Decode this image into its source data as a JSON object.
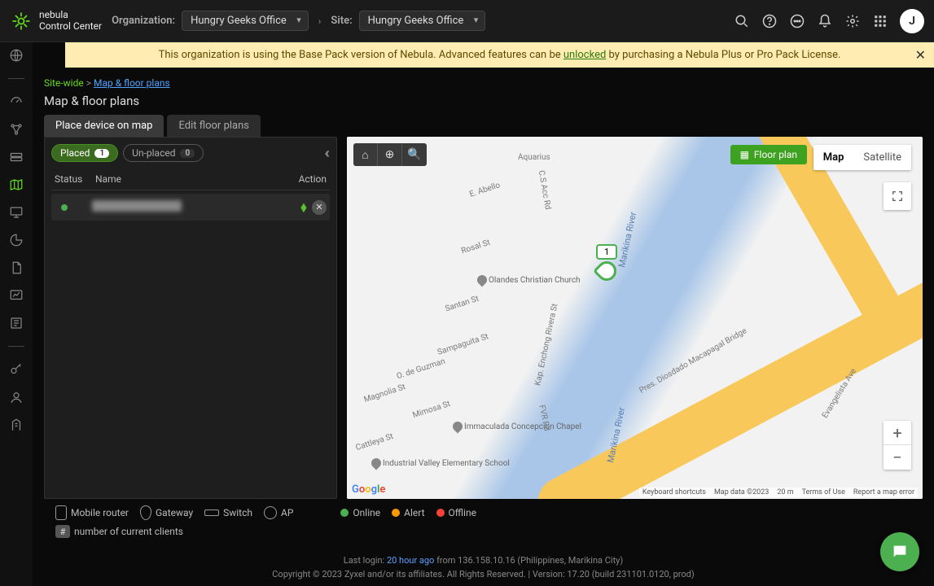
{
  "brand": {
    "name": "nebula",
    "sub": "Control Center"
  },
  "topbar": {
    "org_label": "Organization:",
    "org_value": "Hungry Geeks Office",
    "site_label": "Site:",
    "site_value": "Hungry Geeks Office",
    "avatar_initial": "J"
  },
  "banner": {
    "pre": "This organization is using the Base Pack version of Nebula. Advanced features can be ",
    "link": "unlocked",
    "post": " by purchasing a Nebula Plus or Pro Pack License."
  },
  "crumbs": {
    "root": "Site-wide",
    "sep": ">",
    "leaf": "Map & floor plans"
  },
  "page_title": "Map & floor plans",
  "tabs": {
    "t1": "Place device on map",
    "t2": "Edit floor plans"
  },
  "filters": {
    "placed_label": "Placed",
    "placed_count": "1",
    "unplaced_label": "Un-placed",
    "unplaced_count": "0"
  },
  "table": {
    "h_status": "Status",
    "h_name": "Name",
    "h_action": "Action"
  },
  "map": {
    "toolbar": {
      "home": "⌂",
      "target": "⊕",
      "search": "🔍"
    },
    "floorplan_btn": "Floor plan",
    "type_map": "Map",
    "type_sat": "Satellite",
    "marker_count": "1",
    "river": "Marikina River",
    "bridge": "Pres. Diosdado Macapagal Bridge",
    "poi1": "Olandes Christian Church",
    "poi2": "Immaculada Concepcion Chapel",
    "poi3": "Industrial Valley Elementary School",
    "streets": [
      "E. Abello",
      "Rosal St",
      "Santan St",
      "Sampaguita St",
      "O. de Guzman",
      "Magnolia St",
      "Mimosa St",
      "Cattleya St",
      "Aquarius",
      "C.S Acc Rd",
      "Kap. Enchong Rivera St",
      "FVR Rd",
      "Evangelista Ave"
    ],
    "attr": {
      "shortcuts": "Keyboard shortcuts",
      "data": "Map data ©2023",
      "scale": "20 m",
      "terms": "Terms of Use",
      "report": "Report a map error"
    }
  },
  "legend": {
    "mobile": "Mobile router",
    "gateway": "Gateway",
    "switch": "Switch",
    "ap": "AP",
    "online": "Online",
    "alert": "Alert",
    "offline": "Offline",
    "hash": "#",
    "hash_label": "number of current clients"
  },
  "footer": {
    "login_pre": "Last login:",
    "login_time": "20 hour ago",
    "login_from": "from 136.158.10.16 (Philippines, Marikina City)",
    "copy": "Copyright © 2023 Zyxel and/or its affiliates. All Rights Reserved. | Version: 17.20 (build 231101.0120, prod)"
  }
}
